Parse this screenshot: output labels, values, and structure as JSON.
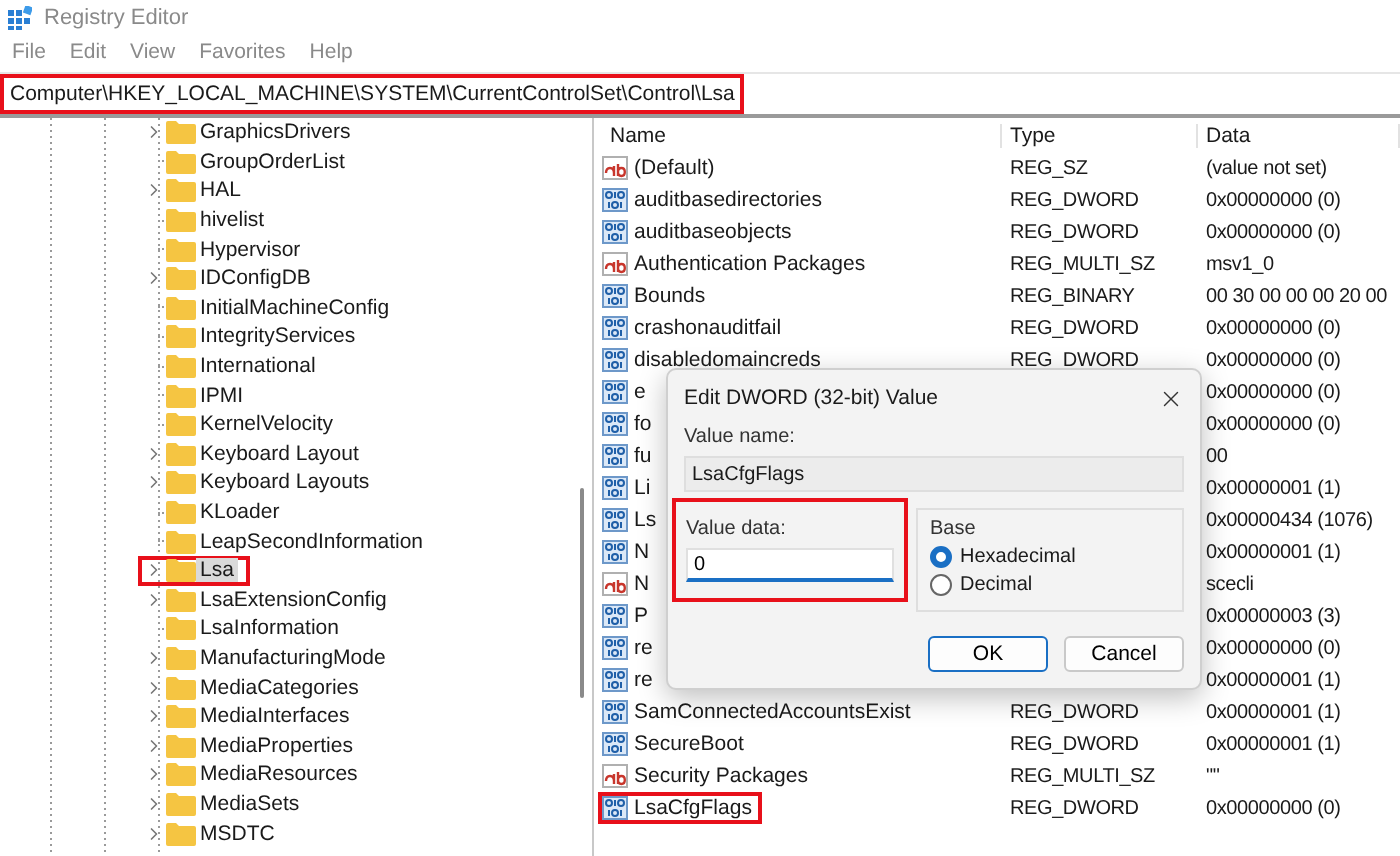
{
  "window": {
    "title": "Registry Editor"
  },
  "menu": [
    "File",
    "Edit",
    "View",
    "Favorites",
    "Help"
  ],
  "address_bar": {
    "path": "Computer\\HKEY_LOCAL_MACHINE\\SYSTEM\\CurrentControlSet\\Control\\Lsa",
    "annotated": true
  },
  "tree": {
    "items": [
      {
        "label": "GraphicsDrivers",
        "has_children": true,
        "selected": false,
        "annotated": false
      },
      {
        "label": "GroupOrderList",
        "has_children": false,
        "selected": false,
        "annotated": false
      },
      {
        "label": "HAL",
        "has_children": true,
        "selected": false,
        "annotated": false
      },
      {
        "label": "hivelist",
        "has_children": false,
        "selected": false,
        "annotated": false
      },
      {
        "label": "Hypervisor",
        "has_children": false,
        "selected": false,
        "annotated": false
      },
      {
        "label": "IDConfigDB",
        "has_children": true,
        "selected": false,
        "annotated": false
      },
      {
        "label": "InitialMachineConfig",
        "has_children": false,
        "selected": false,
        "annotated": false
      },
      {
        "label": "IntegrityServices",
        "has_children": false,
        "selected": false,
        "annotated": false
      },
      {
        "label": "International",
        "has_children": false,
        "selected": false,
        "annotated": false
      },
      {
        "label": "IPMI",
        "has_children": false,
        "selected": false,
        "annotated": false
      },
      {
        "label": "KernelVelocity",
        "has_children": false,
        "selected": false,
        "annotated": false
      },
      {
        "label": "Keyboard Layout",
        "has_children": true,
        "selected": false,
        "annotated": false
      },
      {
        "label": "Keyboard Layouts",
        "has_children": true,
        "selected": false,
        "annotated": false
      },
      {
        "label": "KLoader",
        "has_children": false,
        "selected": false,
        "annotated": false
      },
      {
        "label": "LeapSecondInformation",
        "has_children": false,
        "selected": false,
        "annotated": false
      },
      {
        "label": "Lsa",
        "has_children": true,
        "selected": true,
        "annotated": true
      },
      {
        "label": "LsaExtensionConfig",
        "has_children": true,
        "selected": false,
        "annotated": false
      },
      {
        "label": "LsaInformation",
        "has_children": false,
        "selected": false,
        "annotated": false
      },
      {
        "label": "ManufacturingMode",
        "has_children": true,
        "selected": false,
        "annotated": false
      },
      {
        "label": "MediaCategories",
        "has_children": true,
        "selected": false,
        "annotated": false
      },
      {
        "label": "MediaInterfaces",
        "has_children": true,
        "selected": false,
        "annotated": false
      },
      {
        "label": "MediaProperties",
        "has_children": true,
        "selected": false,
        "annotated": false
      },
      {
        "label": "MediaResources",
        "has_children": true,
        "selected": false,
        "annotated": false
      },
      {
        "label": "MediaSets",
        "has_children": true,
        "selected": false,
        "annotated": false
      },
      {
        "label": "MSDTC",
        "has_children": true,
        "selected": false,
        "annotated": false
      }
    ]
  },
  "values": {
    "columns": [
      "Name",
      "Type",
      "Data"
    ],
    "rows": [
      {
        "kind": "string",
        "name": "(Default)",
        "type": "REG_SZ",
        "data": "(value not set)",
        "annotated": false
      },
      {
        "kind": "binary",
        "name": "auditbasedirectories",
        "type": "REG_DWORD",
        "data": "0x00000000 (0)",
        "annotated": false
      },
      {
        "kind": "binary",
        "name": "auditbaseobjects",
        "type": "REG_DWORD",
        "data": "0x00000000 (0)",
        "annotated": false
      },
      {
        "kind": "string",
        "name": "Authentication Packages",
        "type": "REG_MULTI_SZ",
        "data": "msv1_0",
        "annotated": false
      },
      {
        "kind": "binary",
        "name": "Bounds",
        "type": "REG_BINARY",
        "data": "00 30 00 00 00 20 00",
        "annotated": false
      },
      {
        "kind": "binary",
        "name": "crashonauditfail",
        "type": "REG_DWORD",
        "data": "0x00000000 (0)",
        "annotated": false
      },
      {
        "kind": "binary",
        "name": "disabledomaincreds",
        "type": "REG_DWORD",
        "data": "0x00000000 (0)",
        "annotated": false
      },
      {
        "kind": "binary",
        "name": "e",
        "data": "0x00000000 (0)",
        "annotated": false
      },
      {
        "kind": "binary",
        "name": "fo",
        "data": "0x00000000 (0)",
        "annotated": false
      },
      {
        "kind": "binary",
        "name": "fu",
        "data": "00",
        "annotated": false
      },
      {
        "kind": "binary",
        "name": "Li",
        "data": "0x00000001 (1)",
        "annotated": false
      },
      {
        "kind": "binary",
        "name": "Ls",
        "data": "0x00000434 (1076)",
        "annotated": false
      },
      {
        "kind": "binary",
        "name": "N",
        "data": "0x00000001 (1)",
        "annotated": false
      },
      {
        "kind": "string",
        "name": "N",
        "data": "scecli",
        "annotated": false
      },
      {
        "kind": "binary",
        "name": "P",
        "data": "0x00000003 (3)",
        "annotated": false
      },
      {
        "kind": "binary",
        "name": "re",
        "data": "0x00000000 (0)",
        "annotated": false
      },
      {
        "kind": "binary",
        "name": "re",
        "data": "0x00000001 (1)",
        "annotated": false
      },
      {
        "kind": "binary",
        "name": "SamConnectedAccountsExist",
        "type": "REG_DWORD",
        "data": "0x00000001 (1)",
        "annotated": false
      },
      {
        "kind": "binary",
        "name": "SecureBoot",
        "type": "REG_DWORD",
        "data": "0x00000001 (1)",
        "annotated": false
      },
      {
        "kind": "string",
        "name": "Security Packages",
        "type": "REG_MULTI_SZ",
        "data": "\"\"",
        "annotated": false
      },
      {
        "kind": "binary",
        "name": "LsaCfgFlags",
        "type": "REG_DWORD",
        "data": "0x00000000 (0)",
        "annotated": true
      }
    ]
  },
  "dialog": {
    "title": "Edit DWORD (32-bit) Value",
    "value_name_label": "Value name:",
    "value_name": "LsaCfgFlags",
    "value_data": {
      "label": "Value data:",
      "value": "0",
      "annotated": true
    },
    "base": {
      "label": "Base",
      "options": [
        {
          "label": "Hexadecimal",
          "selected": true
        },
        {
          "label": "Decimal",
          "selected": false
        }
      ]
    },
    "buttons": [
      {
        "label": "OK",
        "default": true
      },
      {
        "label": "Cancel",
        "default": false
      }
    ]
  }
}
